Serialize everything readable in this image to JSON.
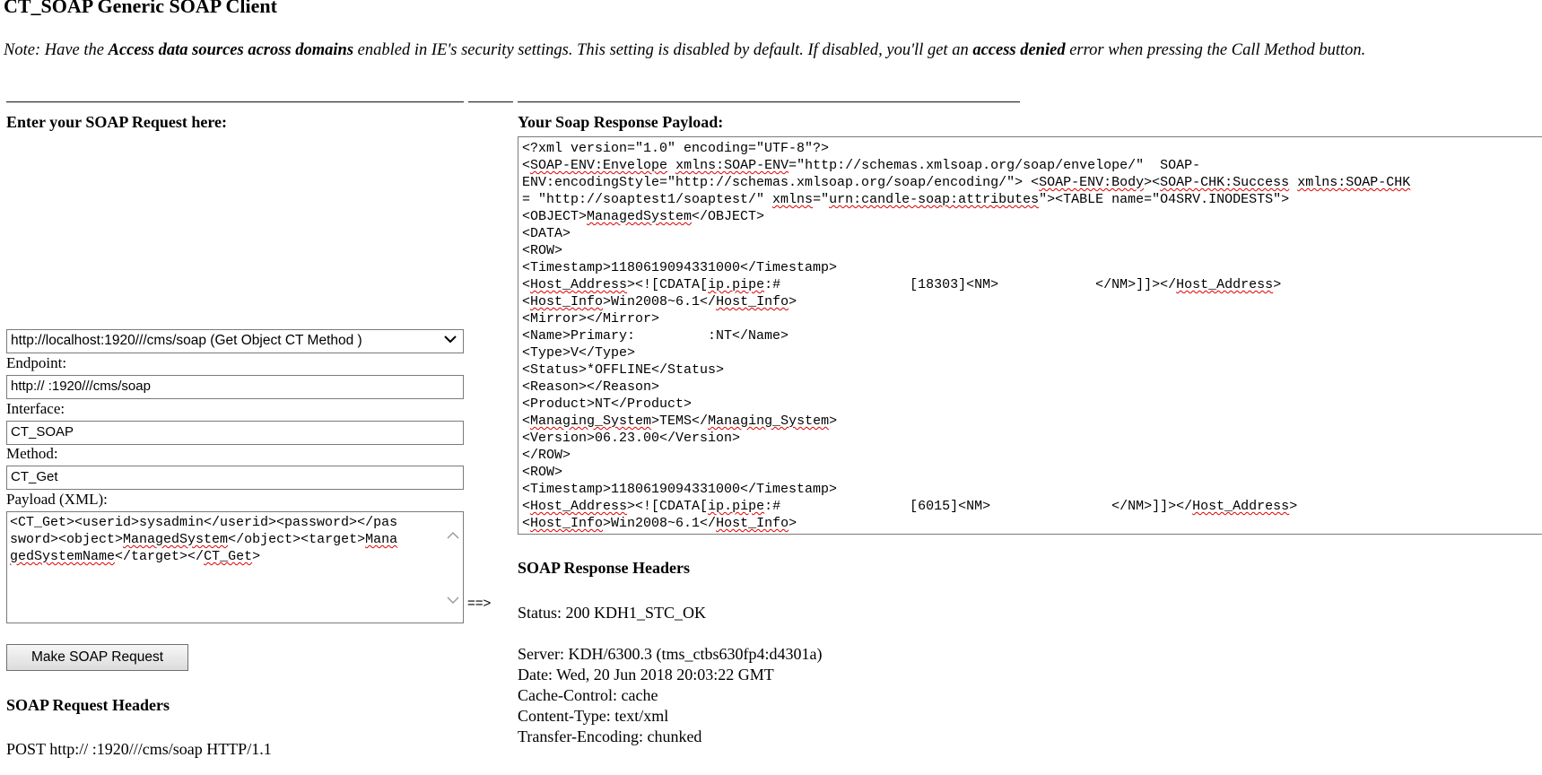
{
  "page": {
    "title": "CT_SOAP Generic SOAP Client",
    "note": [
      {
        "t": "Note: Have the ",
        "b": false
      },
      {
        "t": "Access data sources across domains",
        "b": true
      },
      {
        "t": " enabled in IE's security settings. This setting is disabled by default. If disabled, you'll get an ",
        "b": false
      },
      {
        "t": "access denied",
        "b": true
      },
      {
        "t": " error when pressing the Call Method button.",
        "b": false
      }
    ]
  },
  "request": {
    "heading": "Enter your SOAP Request here:",
    "method_select": "http://localhost:1920///cms/soap (Get Object CT Method )",
    "endpoint_label": "Endpoint:",
    "endpoint_value": "http://                              :1920///cms/soap",
    "interface_label": "Interface:",
    "interface_value": "CT_SOAP",
    "method_label": "Method:",
    "method_value": "CT_Get",
    "payload_label": "Payload (XML):",
    "payload_lines": [
      [
        [
          "<CT_Get><userid>sysadmin</userid><password></pas",
          ""
        ]
      ],
      [
        [
          "sword><object>",
          ""
        ],
        [
          "ManagedSystem",
          "sq"
        ],
        [
          "</object><target>",
          ""
        ],
        [
          "Mana",
          "sq"
        ]
      ],
      [
        [
          "gedSystemName",
          "sq"
        ],
        [
          "</target></",
          ""
        ],
        [
          "CT_Get",
          "sq"
        ],
        [
          ">",
          ""
        ]
      ]
    ],
    "submit_label": "Make SOAP Request",
    "arrow": "==>"
  },
  "request_headers": {
    "heading": "SOAP Request Headers",
    "line": "POST http://                              :1920///cms/soap  HTTP/1.1"
  },
  "response": {
    "heading": "Your Soap Response Payload:",
    "lines": [
      [
        [
          "<?xml version=\"1.0\" encoding=\"UTF-8\"?>",
          ""
        ]
      ],
      [
        [
          "<",
          ""
        ],
        [
          "SOAP-ENV:Envelope",
          "sq"
        ],
        [
          " ",
          ""
        ],
        [
          "xmlns:SOAP-ENV",
          "sq"
        ],
        [
          "=\"http://schemas.xmlsoap.org/soap/envelope/\"  SOAP-",
          ""
        ]
      ],
      [
        [
          "ENV:encodingStyle=\"http://schemas.xmlsoap.org/soap/encoding/\"> <",
          ""
        ],
        [
          "SOAP-ENV:Body",
          "sq"
        ],
        [
          "><",
          ""
        ],
        [
          "SOAP-CHK:Success",
          "sq"
        ],
        [
          " ",
          ""
        ],
        [
          "xmlns:SOAP-CHK",
          "sq"
        ]
      ],
      [
        [
          "= \"http://soaptest1/soaptest/\" ",
          ""
        ],
        [
          "xmlns",
          "sq"
        ],
        [
          "=\"",
          ""
        ],
        [
          "urn:candle-soap:attributes",
          "sq"
        ],
        [
          "\"><TABLE name=\"O4SRV.INODESTS\">",
          ""
        ]
      ],
      [
        [
          "<OBJECT>",
          ""
        ],
        [
          "ManagedSystem",
          "sq"
        ],
        [
          "</OBJECT>",
          ""
        ]
      ],
      [
        [
          "<DATA>",
          ""
        ]
      ],
      [
        [
          "<ROW>",
          ""
        ]
      ],
      [
        [
          "<Timestamp>1180619094331000</Timestamp>",
          ""
        ]
      ],
      [
        [
          "<",
          ""
        ],
        [
          "Host_Address",
          "sq"
        ],
        [
          "><![CDATA[",
          ""
        ],
        [
          "ip.pipe",
          "sq"
        ],
        [
          ":#                [18303]<NM>            </NM>]]></",
          ""
        ],
        [
          "Host_Address",
          "sq"
        ],
        [
          ">",
          ""
        ]
      ],
      [
        [
          "<",
          ""
        ],
        [
          "Host_Info",
          "sq"
        ],
        [
          ">Win2008~6.1</",
          ""
        ],
        [
          "Host_Info",
          "sq"
        ],
        [
          ">",
          ""
        ]
      ],
      [
        [
          "<Mirror></Mirror>",
          ""
        ]
      ],
      [
        [
          "<Name>Primary:         :NT</Name>",
          ""
        ]
      ],
      [
        [
          "<Type>V</Type>",
          ""
        ]
      ],
      [
        [
          "<Status>*OFFLINE</Status>",
          ""
        ]
      ],
      [
        [
          "<Reason></Reason>",
          ""
        ]
      ],
      [
        [
          "<Product>NT</Product>",
          ""
        ]
      ],
      [
        [
          "<",
          ""
        ],
        [
          "Managing_System",
          "sq"
        ],
        [
          ">TEMS</",
          ""
        ],
        [
          "Managing_System",
          "sq"
        ],
        [
          ">",
          ""
        ]
      ],
      [
        [
          "<Version>06.23.00</Version>",
          ""
        ]
      ],
      [
        [
          "</ROW>",
          ""
        ]
      ],
      [
        [
          "<ROW>",
          ""
        ]
      ],
      [
        [
          "<Timestamp>1180619094331000</Timestamp>",
          ""
        ]
      ],
      [
        [
          "<",
          ""
        ],
        [
          "Host_Address",
          "sq"
        ],
        [
          "><![CDATA[",
          ""
        ],
        [
          "ip.pipe",
          "sq"
        ],
        [
          ":#                [6015]<NM>               </NM>]]></",
          ""
        ],
        [
          "Host_Address",
          "sq"
        ],
        [
          ">",
          ""
        ]
      ],
      [
        [
          "<",
          ""
        ],
        [
          "Host_Info",
          "sq"
        ],
        [
          ">Win2008~6.1</",
          ""
        ],
        [
          "Host_Info",
          "sq"
        ],
        [
          ">",
          ""
        ]
      ]
    ]
  },
  "response_headers": {
    "heading": "SOAP Response Headers",
    "status": "Status: 200 KDH1_STC_OK",
    "server": "Server: KDH/6300.3 (tms_ctbs630fp4:d4301a)",
    "date": "Date: Wed, 20 Jun 2018 20:03:22 GMT",
    "cache": "Cache-Control: cache",
    "content_type": "Content-Type: text/xml",
    "transfer": "Transfer-Encoding: chunked"
  },
  "icons": {
    "select": "chevron-down-icon",
    "scroll": "scroll-arrow-icons"
  }
}
